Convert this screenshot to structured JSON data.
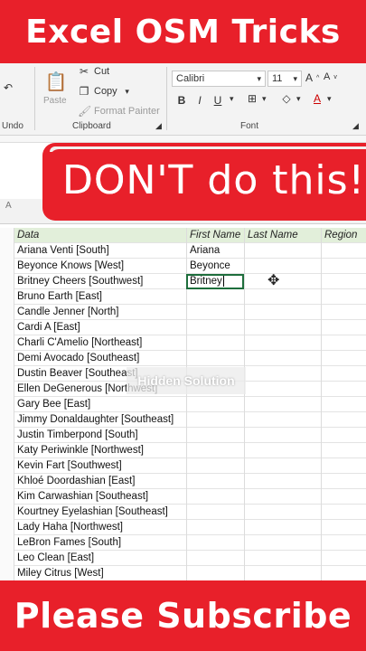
{
  "banners": {
    "top": "Excel OSM Tricks",
    "bottom": "Please Subscribe"
  },
  "ribbon": {
    "undo_label": "Undo",
    "clipboard": {
      "paste": "Paste",
      "cut": "Cut",
      "copy": "Copy",
      "format_painter": "Format Painter",
      "group_label": "Clipboard"
    },
    "font": {
      "name": "Calibri",
      "size": "11",
      "group_label": "Font",
      "bold": "B",
      "italic": "I",
      "underline": "U"
    }
  },
  "overlay": {
    "warning": "DON'T do this!",
    "watermark": "Hidden Solution",
    "column_a_label": "A"
  },
  "sheet": {
    "headers": [
      "Data",
      "First Name",
      "Last Name",
      "Region"
    ],
    "rows": [
      [
        "Ariana Venti [South]",
        "Ariana",
        "",
        ""
      ],
      [
        "Beyonce Knows [West]",
        "Beyonce",
        "",
        ""
      ],
      [
        "Britney Cheers [Southwest]",
        "Britney",
        "",
        ""
      ],
      [
        "Bruno Earth [East]",
        "",
        "",
        ""
      ],
      [
        "Candle Jenner [North]",
        "",
        "",
        ""
      ],
      [
        "Cardi A [East]",
        "",
        "",
        ""
      ],
      [
        "Charli C'Amelio [Northeast]",
        "",
        "",
        ""
      ],
      [
        "Demi Avocado [Southeast]",
        "",
        "",
        ""
      ],
      [
        "Dustin Beaver [Southeast]",
        "",
        "",
        ""
      ],
      [
        "Ellen DeGenerous [Northwest]",
        "",
        "",
        ""
      ],
      [
        "Gary Bee [East]",
        "",
        "",
        ""
      ],
      [
        "Jimmy Donaldaughter [Southeast]",
        "",
        "",
        ""
      ],
      [
        "Justin Timberpond [South]",
        "",
        "",
        ""
      ],
      [
        "Katy Periwinkle [Northwest]",
        "",
        "",
        ""
      ],
      [
        "Kevin Fart [Southwest]",
        "",
        "",
        ""
      ],
      [
        "Khloé Doordashian [East]",
        "",
        "",
        ""
      ],
      [
        "Kim Carwashian [Southeast]",
        "",
        "",
        ""
      ],
      [
        "Kourtney Eyelashian [Southeast]",
        "",
        "",
        ""
      ],
      [
        "Lady Haha [Northwest]",
        "",
        "",
        ""
      ],
      [
        "LeBron Fames [South]",
        "",
        "",
        ""
      ],
      [
        "Leo Clean [East]",
        "",
        "",
        ""
      ],
      [
        "Miley Citrus [West]",
        "",
        "",
        ""
      ]
    ],
    "active_cell": {
      "row": 2,
      "col": 1
    }
  },
  "colors": {
    "banner_red": "#e8202a",
    "header_green": "#e2efda",
    "excel_green": "#1e6e3c"
  }
}
